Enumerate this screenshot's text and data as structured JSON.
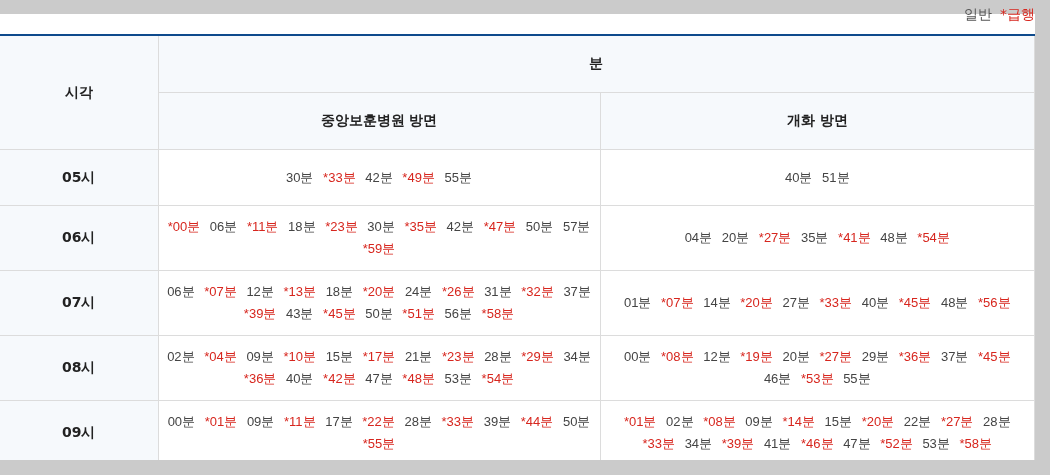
{
  "legend": [
    {
      "label": "일반",
      "kind": "normal"
    },
    {
      "label": "*급행",
      "kind": "express"
    }
  ],
  "table": {
    "time_header": "시각",
    "minute_header": "분",
    "directions": [
      "중앙보훈병원 방면",
      "개화 방면"
    ],
    "rows": [
      {
        "hour": "05시",
        "departures": [
          [
            {
              "text": "30분",
              "express": false
            },
            {
              "text": "*33분",
              "express": true
            },
            {
              "text": "42분",
              "express": false
            },
            {
              "text": "*49분",
              "express": true
            },
            {
              "text": "55분",
              "express": false
            }
          ],
          [
            {
              "text": "40분",
              "express": false
            },
            {
              "text": "51분",
              "express": false
            }
          ]
        ]
      },
      {
        "hour": "06시",
        "departures": [
          [
            {
              "text": "*00분",
              "express": true
            },
            {
              "text": "06분",
              "express": false
            },
            {
              "text": "*11분",
              "express": true
            },
            {
              "text": "18분",
              "express": false
            },
            {
              "text": "*23분",
              "express": true
            },
            {
              "text": "30분",
              "express": false
            },
            {
              "text": "*35분",
              "express": true
            },
            {
              "text": "42분",
              "express": false
            },
            {
              "text": "*47분",
              "express": true
            },
            {
              "text": "50분",
              "express": false
            },
            {
              "text": "57분",
              "express": false
            },
            {
              "text": "*59분",
              "express": true
            }
          ],
          [
            {
              "text": "04분",
              "express": false
            },
            {
              "text": "20분",
              "express": false
            },
            {
              "text": "*27분",
              "express": true
            },
            {
              "text": "35분",
              "express": false
            },
            {
              "text": "*41분",
              "express": true
            },
            {
              "text": "48분",
              "express": false
            },
            {
              "text": "*54분",
              "express": true
            }
          ]
        ]
      },
      {
        "hour": "07시",
        "departures": [
          [
            {
              "text": "06분",
              "express": false
            },
            {
              "text": "*07분",
              "express": true
            },
            {
              "text": "12분",
              "express": false
            },
            {
              "text": "*13분",
              "express": true
            },
            {
              "text": "18분",
              "express": false
            },
            {
              "text": "*20분",
              "express": true
            },
            {
              "text": "24분",
              "express": false
            },
            {
              "text": "*26분",
              "express": true
            },
            {
              "text": "31분",
              "express": false
            },
            {
              "text": "*32분",
              "express": true
            },
            {
              "text": "37분",
              "express": false
            },
            {
              "text": "*39분",
              "express": true
            },
            {
              "text": "43분",
              "express": false
            },
            {
              "text": "*45분",
              "express": true
            },
            {
              "text": "50분",
              "express": false
            },
            {
              "text": "*51분",
              "express": true
            },
            {
              "text": "56분",
              "express": false
            },
            {
              "text": "*58분",
              "express": true
            }
          ],
          [
            {
              "text": "01분",
              "express": false
            },
            {
              "text": "*07분",
              "express": true
            },
            {
              "text": "14분",
              "express": false
            },
            {
              "text": "*20분",
              "express": true
            },
            {
              "text": "27분",
              "express": false
            },
            {
              "text": "*33분",
              "express": true
            },
            {
              "text": "40분",
              "express": false
            },
            {
              "text": "*45분",
              "express": true
            },
            {
              "text": "48분",
              "express": false
            },
            {
              "text": "*56분",
              "express": true
            }
          ]
        ]
      },
      {
        "hour": "08시",
        "departures": [
          [
            {
              "text": "02분",
              "express": false
            },
            {
              "text": "*04분",
              "express": true
            },
            {
              "text": "09분",
              "express": false
            },
            {
              "text": "*10분",
              "express": true
            },
            {
              "text": "15분",
              "express": false
            },
            {
              "text": "*17분",
              "express": true
            },
            {
              "text": "21분",
              "express": false
            },
            {
              "text": "*23분",
              "express": true
            },
            {
              "text": "28분",
              "express": false
            },
            {
              "text": "*29분",
              "express": true
            },
            {
              "text": "34분",
              "express": false
            },
            {
              "text": "*36분",
              "express": true
            },
            {
              "text": "40분",
              "express": false
            },
            {
              "text": "*42분",
              "express": true
            },
            {
              "text": "47분",
              "express": false
            },
            {
              "text": "*48분",
              "express": true
            },
            {
              "text": "53분",
              "express": false
            },
            {
              "text": "*54분",
              "express": true
            }
          ],
          [
            {
              "text": "00분",
              "express": false
            },
            {
              "text": "*08분",
              "express": true
            },
            {
              "text": "12분",
              "express": false
            },
            {
              "text": "*19분",
              "express": true
            },
            {
              "text": "20분",
              "express": false
            },
            {
              "text": "*27분",
              "express": true
            },
            {
              "text": "29분",
              "express": false
            },
            {
              "text": "*36분",
              "express": true
            },
            {
              "text": "37분",
              "express": false
            },
            {
              "text": "*45분",
              "express": true
            },
            {
              "text": "46분",
              "express": false
            },
            {
              "text": "*53분",
              "express": true
            },
            {
              "text": "55분",
              "express": false
            }
          ]
        ]
      },
      {
        "hour": "09시",
        "departures": [
          [
            {
              "text": "00분",
              "express": false
            },
            {
              "text": "*01분",
              "express": true
            },
            {
              "text": "09분",
              "express": false
            },
            {
              "text": "*11분",
              "express": true
            },
            {
              "text": "17분",
              "express": false
            },
            {
              "text": "*22분",
              "express": true
            },
            {
              "text": "28분",
              "express": false
            },
            {
              "text": "*33분",
              "express": true
            },
            {
              "text": "39분",
              "express": false
            },
            {
              "text": "*44분",
              "express": true
            },
            {
              "text": "50분",
              "express": false
            },
            {
              "text": "*55분",
              "express": true
            }
          ],
          [
            {
              "text": "*01분",
              "express": true
            },
            {
              "text": "02분",
              "express": false
            },
            {
              "text": "*08분",
              "express": true
            },
            {
              "text": "09분",
              "express": false
            },
            {
              "text": "*14분",
              "express": true
            },
            {
              "text": "15분",
              "express": false
            },
            {
              "text": "*20분",
              "express": true
            },
            {
              "text": "22분",
              "express": false
            },
            {
              "text": "*27분",
              "express": true
            },
            {
              "text": "28분",
              "express": false
            },
            {
              "text": "*33분",
              "express": true
            },
            {
              "text": "34분",
              "express": false
            },
            {
              "text": "*39분",
              "express": true
            },
            {
              "text": "41분",
              "express": false
            },
            {
              "text": "*46분",
              "express": true
            },
            {
              "text": "47분",
              "express": false
            },
            {
              "text": "*52분",
              "express": true
            },
            {
              "text": "53분",
              "express": false
            },
            {
              "text": "*58분",
              "express": true
            }
          ]
        ]
      }
    ]
  }
}
